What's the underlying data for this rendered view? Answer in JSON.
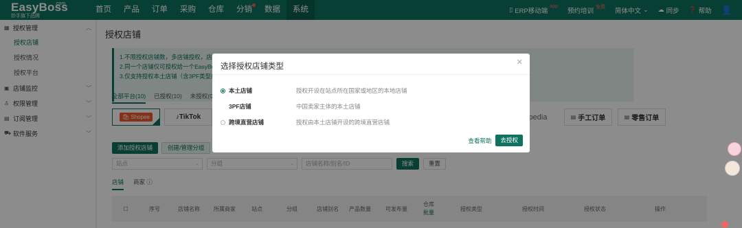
{
  "logo": {
    "name": "EasyBoss",
    "sub": "妙手旗下品牌",
    "com": ".com"
  },
  "nav": {
    "items": [
      "首页",
      "产品",
      "订单",
      "采购",
      "仓库",
      "分销",
      "数据",
      "系统"
    ],
    "right": {
      "erp": "ERP移动端",
      "erp_tag": "app",
      "training": "预约培训",
      "training_tag": "免费",
      "lang": "简体中文",
      "sync": "同步",
      "help": "帮助"
    }
  },
  "sidebar": {
    "groups": [
      {
        "label": "授权管理",
        "subs": [
          "授权店铺",
          "授权情况",
          "授权平台"
        ]
      },
      {
        "label": "店铺监控",
        "subs": []
      },
      {
        "label": "权限管理",
        "subs": []
      },
      {
        "label": "订阅管理",
        "subs": []
      },
      {
        "label": "软件服务",
        "subs": []
      }
    ]
  },
  "page": {
    "title": "授权店铺",
    "notice": [
      "1.不限授权店铺数，多店铺授权，店铺",
      "2.同一个店铺仅可授权给一个EasyBoss",
      "3.仅支持授权本土店铺（含3PF类型店铺"
    ],
    "tabs": [
      "全部平台(10)",
      "已授权(10)",
      "未授权(0)"
    ],
    "platforms": {
      "shopee": "Shopee",
      "tiktok": "TikTok",
      "pedia": "pedia",
      "manual": "手工订单",
      "retail": "零售订单"
    },
    "buttons": {
      "add": "添加授权店铺",
      "group": "创建/管理分组"
    },
    "filters": {
      "site": "站点",
      "group": "分组",
      "search_ph": "店铺名称/别名/ID",
      "search": "搜索",
      "reset": "重置"
    },
    "tabs2": [
      "店铺",
      "商家"
    ],
    "table_headers": [
      "序号",
      "店铺名称",
      "所属商家",
      "站点",
      "分组",
      "店铺别名",
      "产品数量",
      "可发布量",
      "仓库",
      "授权类型",
      "授权时间",
      "授权状态",
      "操作"
    ],
    "table_sub": "批量"
  },
  "modal": {
    "title": "选择授权店铺类型",
    "options": [
      {
        "label": "本土店铺",
        "desc": "授权开设在站点所在国家或地区的本地店铺",
        "selected": true
      },
      {
        "label": "3PF店铺",
        "desc": "中国卖家主体的本土店铺",
        "selected": false
      },
      {
        "label": "跨境直营店铺",
        "desc": "授权由本土店铺开设的跨境直营店铺",
        "selected": false
      }
    ],
    "help": "查看帮助",
    "confirm": "去授权"
  },
  "colors": {
    "brand": "#10735f",
    "overlay": "rgba(0,0,0,0.45)"
  }
}
